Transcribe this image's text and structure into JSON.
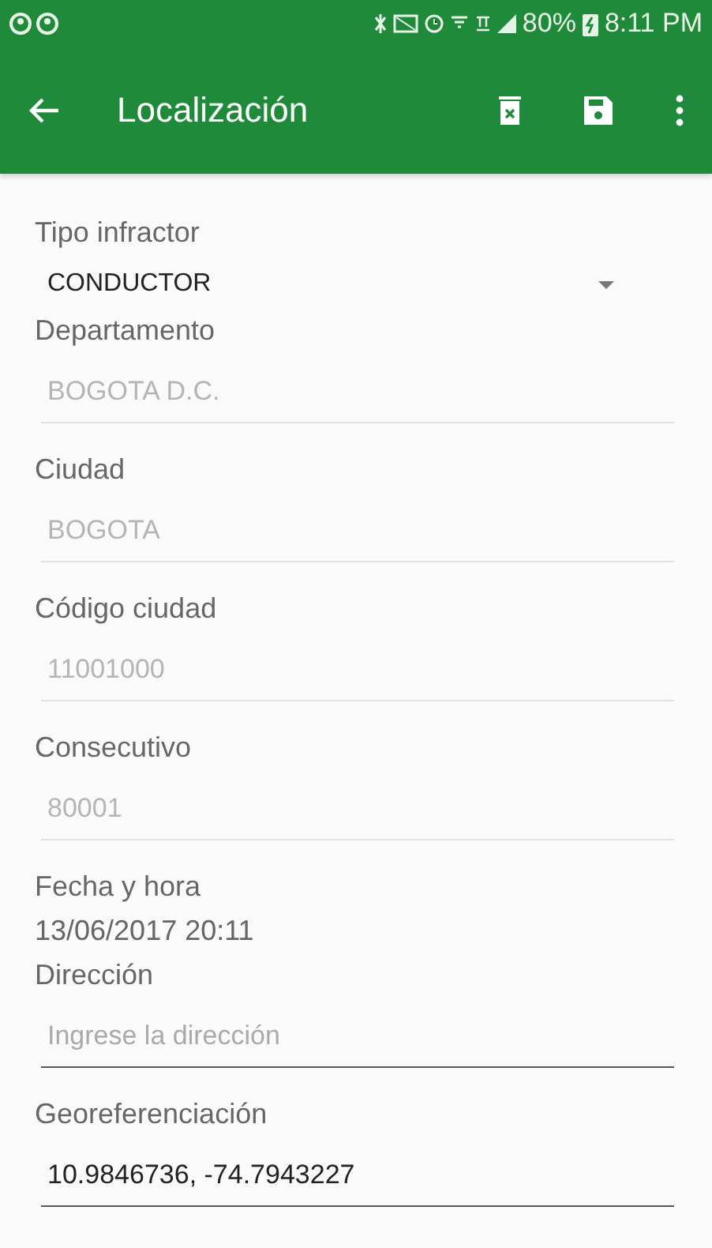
{
  "status_bar": {
    "battery": "80%",
    "time": "8:11 PM"
  },
  "app_bar": {
    "title": "Localización"
  },
  "form": [
    {
      "kind": "dropdown",
      "label": "Tipo infractor",
      "value": "CONDUCTOR"
    },
    {
      "kind": "field",
      "label": "Departamento",
      "value": "BOGOTA D.C.",
      "disabled": true
    },
    {
      "kind": "field",
      "label": "Ciudad",
      "value": "BOGOTA",
      "disabled": true
    },
    {
      "kind": "field",
      "label": "Código ciudad",
      "value": "11001000",
      "disabled": true
    },
    {
      "kind": "field",
      "label": "Consecutivo",
      "value": "80001",
      "disabled": true
    },
    {
      "kind": "text",
      "label": "Fecha y hora",
      "value": "13/06/2017 20:11"
    },
    {
      "kind": "field",
      "label": "Dirección",
      "placeholder": "Ingrese la dirección",
      "disabled": false
    },
    {
      "kind": "field",
      "label": "Georeferenciación",
      "value": "10.9846736, -74.7943227",
      "disabled": false
    }
  ]
}
